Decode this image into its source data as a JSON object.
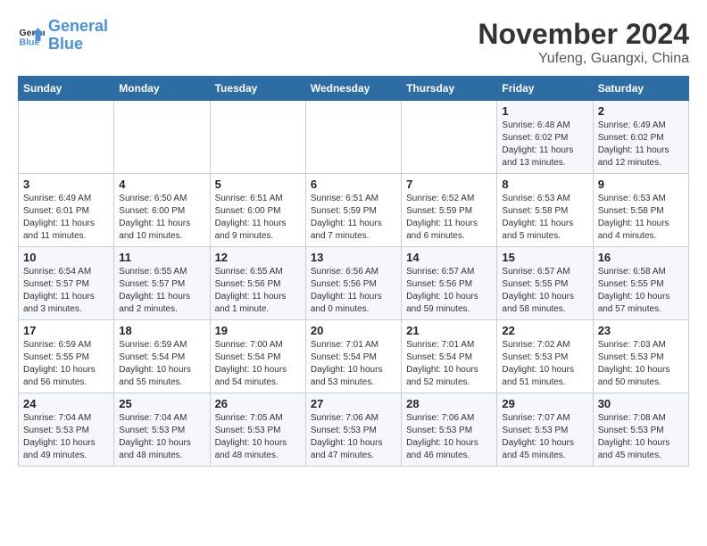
{
  "header": {
    "logo_line1": "General",
    "logo_line2": "Blue",
    "month": "November 2024",
    "location": "Yufeng, Guangxi, China"
  },
  "weekdays": [
    "Sunday",
    "Monday",
    "Tuesday",
    "Wednesday",
    "Thursday",
    "Friday",
    "Saturday"
  ],
  "weeks": [
    [
      {
        "day": "",
        "info": ""
      },
      {
        "day": "",
        "info": ""
      },
      {
        "day": "",
        "info": ""
      },
      {
        "day": "",
        "info": ""
      },
      {
        "day": "",
        "info": ""
      },
      {
        "day": "1",
        "info": "Sunrise: 6:48 AM\nSunset: 6:02 PM\nDaylight: 11 hours\nand 13 minutes."
      },
      {
        "day": "2",
        "info": "Sunrise: 6:49 AM\nSunset: 6:02 PM\nDaylight: 11 hours\nand 12 minutes."
      }
    ],
    [
      {
        "day": "3",
        "info": "Sunrise: 6:49 AM\nSunset: 6:01 PM\nDaylight: 11 hours\nand 11 minutes."
      },
      {
        "day": "4",
        "info": "Sunrise: 6:50 AM\nSunset: 6:00 PM\nDaylight: 11 hours\nand 10 minutes."
      },
      {
        "day": "5",
        "info": "Sunrise: 6:51 AM\nSunset: 6:00 PM\nDaylight: 11 hours\nand 9 minutes."
      },
      {
        "day": "6",
        "info": "Sunrise: 6:51 AM\nSunset: 5:59 PM\nDaylight: 11 hours\nand 7 minutes."
      },
      {
        "day": "7",
        "info": "Sunrise: 6:52 AM\nSunset: 5:59 PM\nDaylight: 11 hours\nand 6 minutes."
      },
      {
        "day": "8",
        "info": "Sunrise: 6:53 AM\nSunset: 5:58 PM\nDaylight: 11 hours\nand 5 minutes."
      },
      {
        "day": "9",
        "info": "Sunrise: 6:53 AM\nSunset: 5:58 PM\nDaylight: 11 hours\nand 4 minutes."
      }
    ],
    [
      {
        "day": "10",
        "info": "Sunrise: 6:54 AM\nSunset: 5:57 PM\nDaylight: 11 hours\nand 3 minutes."
      },
      {
        "day": "11",
        "info": "Sunrise: 6:55 AM\nSunset: 5:57 PM\nDaylight: 11 hours\nand 2 minutes."
      },
      {
        "day": "12",
        "info": "Sunrise: 6:55 AM\nSunset: 5:56 PM\nDaylight: 11 hours\nand 1 minute."
      },
      {
        "day": "13",
        "info": "Sunrise: 6:56 AM\nSunset: 5:56 PM\nDaylight: 11 hours\nand 0 minutes."
      },
      {
        "day": "14",
        "info": "Sunrise: 6:57 AM\nSunset: 5:56 PM\nDaylight: 10 hours\nand 59 minutes."
      },
      {
        "day": "15",
        "info": "Sunrise: 6:57 AM\nSunset: 5:55 PM\nDaylight: 10 hours\nand 58 minutes."
      },
      {
        "day": "16",
        "info": "Sunrise: 6:58 AM\nSunset: 5:55 PM\nDaylight: 10 hours\nand 57 minutes."
      }
    ],
    [
      {
        "day": "17",
        "info": "Sunrise: 6:59 AM\nSunset: 5:55 PM\nDaylight: 10 hours\nand 56 minutes."
      },
      {
        "day": "18",
        "info": "Sunrise: 6:59 AM\nSunset: 5:54 PM\nDaylight: 10 hours\nand 55 minutes."
      },
      {
        "day": "19",
        "info": "Sunrise: 7:00 AM\nSunset: 5:54 PM\nDaylight: 10 hours\nand 54 minutes."
      },
      {
        "day": "20",
        "info": "Sunrise: 7:01 AM\nSunset: 5:54 PM\nDaylight: 10 hours\nand 53 minutes."
      },
      {
        "day": "21",
        "info": "Sunrise: 7:01 AM\nSunset: 5:54 PM\nDaylight: 10 hours\nand 52 minutes."
      },
      {
        "day": "22",
        "info": "Sunrise: 7:02 AM\nSunset: 5:53 PM\nDaylight: 10 hours\nand 51 minutes."
      },
      {
        "day": "23",
        "info": "Sunrise: 7:03 AM\nSunset: 5:53 PM\nDaylight: 10 hours\nand 50 minutes."
      }
    ],
    [
      {
        "day": "24",
        "info": "Sunrise: 7:04 AM\nSunset: 5:53 PM\nDaylight: 10 hours\nand 49 minutes."
      },
      {
        "day": "25",
        "info": "Sunrise: 7:04 AM\nSunset: 5:53 PM\nDaylight: 10 hours\nand 48 minutes."
      },
      {
        "day": "26",
        "info": "Sunrise: 7:05 AM\nSunset: 5:53 PM\nDaylight: 10 hours\nand 48 minutes."
      },
      {
        "day": "27",
        "info": "Sunrise: 7:06 AM\nSunset: 5:53 PM\nDaylight: 10 hours\nand 47 minutes."
      },
      {
        "day": "28",
        "info": "Sunrise: 7:06 AM\nSunset: 5:53 PM\nDaylight: 10 hours\nand 46 minutes."
      },
      {
        "day": "29",
        "info": "Sunrise: 7:07 AM\nSunset: 5:53 PM\nDaylight: 10 hours\nand 45 minutes."
      },
      {
        "day": "30",
        "info": "Sunrise: 7:08 AM\nSunset: 5:53 PM\nDaylight: 10 hours\nand 45 minutes."
      }
    ]
  ]
}
